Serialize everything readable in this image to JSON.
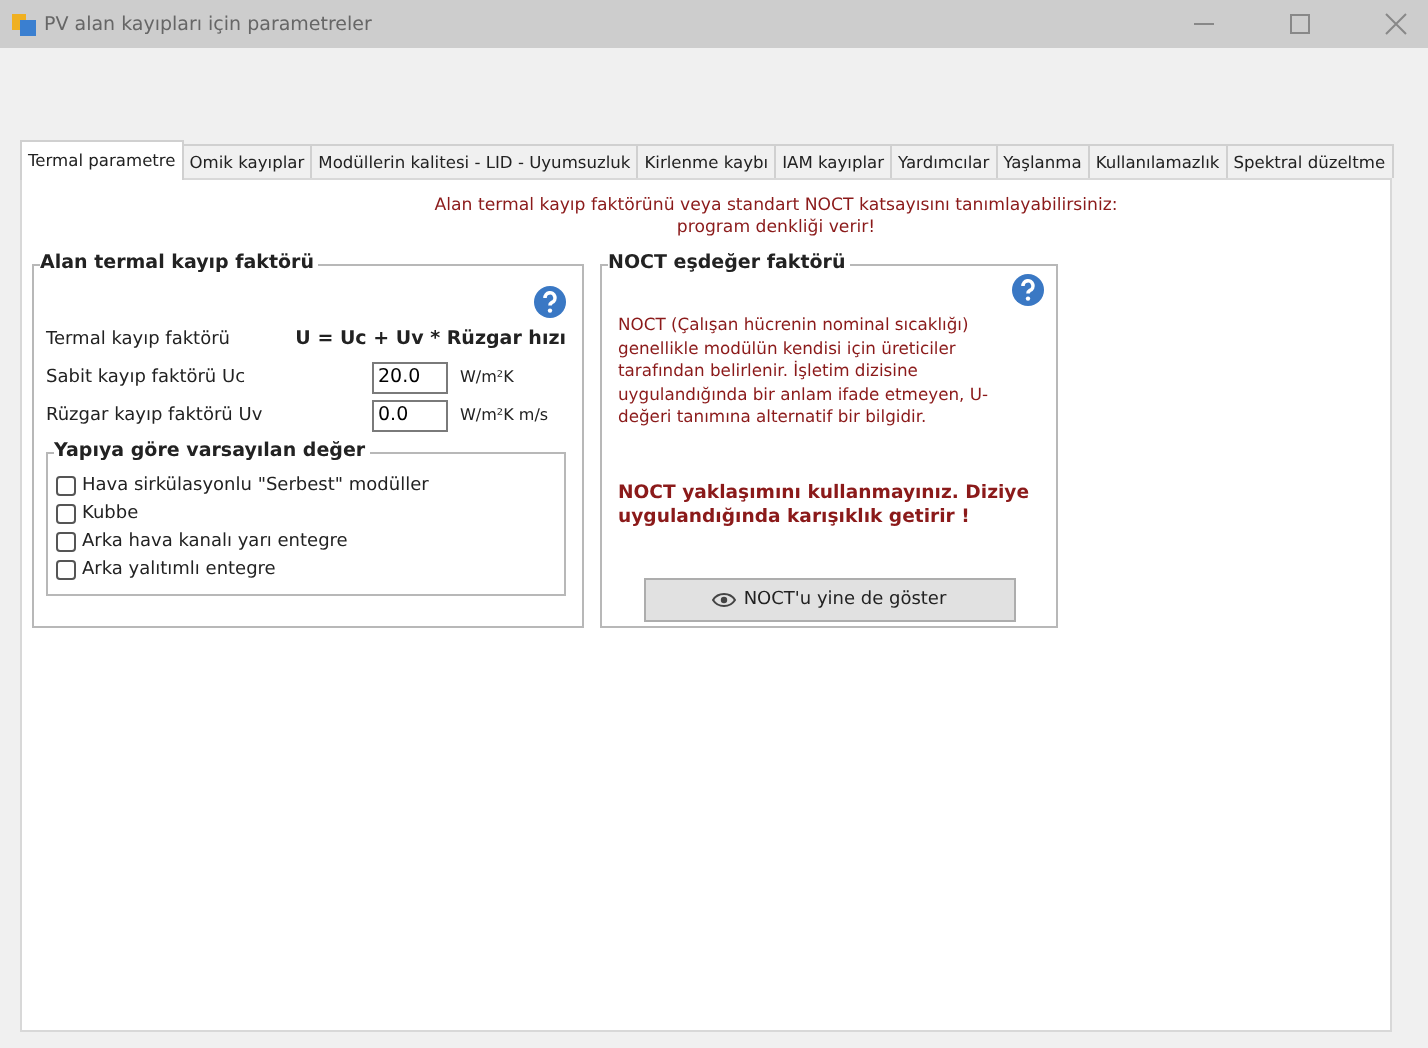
{
  "window": {
    "title": "PV alan kayıpları için parametreler"
  },
  "tabs": [
    {
      "label": "Termal parametre",
      "selected": true
    },
    {
      "label": "Omik kayıplar",
      "selected": false
    },
    {
      "label": "Modüllerin kalitesi - LID - Uyumsuzluk",
      "selected": false
    },
    {
      "label": "Kirlenme kaybı",
      "selected": false
    },
    {
      "label": "IAM kayıplar",
      "selected": false
    },
    {
      "label": "Yardımcılar",
      "selected": false
    },
    {
      "label": "Yaşlanma",
      "selected": false
    },
    {
      "label": "Kullanılamazlık",
      "selected": false
    },
    {
      "label": "Spektral düzeltme",
      "selected": false
    }
  ],
  "intro": [
    "Alan termal kayıp faktörünü veya standart NOCT katsayısını tanımlayabilirsiniz:",
    "program denkliği verir!"
  ],
  "thermal_group": {
    "title": "Alan termal kayıp faktörü",
    "formula_label": "Termal kayıp faktörü",
    "formula": "U = Uc + Uv * Rüzgar hızı",
    "fields": [
      {
        "label": "Sabit kayıp faktörü Uc",
        "value": "20.0",
        "unit": "W/m²K"
      },
      {
        "label": "Rüzgar kayıp faktörü Uv",
        "value": "0.0",
        "unit": "W/m²K m/s"
      }
    ],
    "defaults": {
      "title": "Yapıya göre varsayılan değer",
      "options": [
        {
          "label": "Hava sirkülasyonlu \"Serbest\" modüller",
          "checked": false
        },
        {
          "label": "Kubbe",
          "checked": false
        },
        {
          "label": "Arka hava kanalı yarı entegre",
          "checked": false
        },
        {
          "label": "Arka yalıtımlı entegre",
          "checked": false
        }
      ]
    }
  },
  "noct_group": {
    "title": "NOCT eşdeğer faktörü",
    "description": "NOCT (Çalışan hücrenin nominal sıcaklığı) genellikle modülün kendisi için üreticiler tarafından belirlenir. İşletim dizisine uygulandığında bir anlam ifade etmeyen, U-değeri tanımına alternatif bir bilgidir.",
    "warning": "NOCT yaklaşımını kullanmayınız. Diziye uygulandığında karışıklık getirir !",
    "button": "NOCT'u yine de göster"
  }
}
